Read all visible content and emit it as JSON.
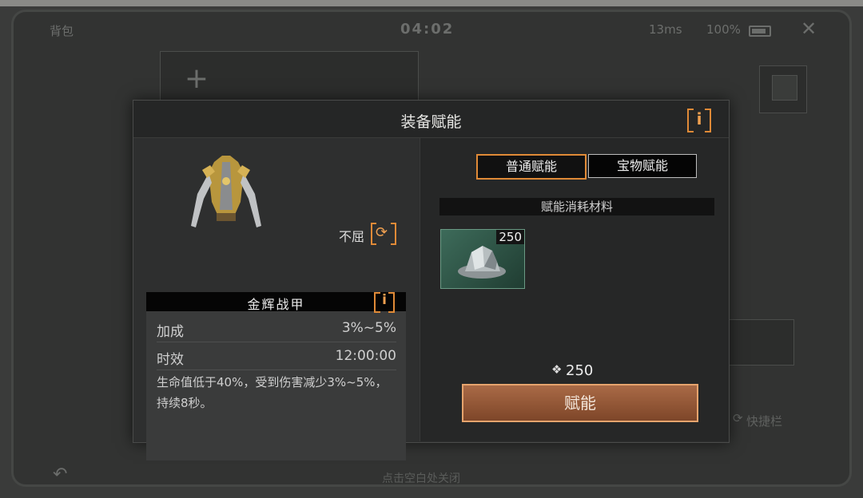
{
  "status": {
    "time": "04:02",
    "back_text": "背包",
    "ping": "13ms",
    "battery": "100%"
  },
  "background": {
    "hint": "点击空白处关闭",
    "quickbar": "快捷栏"
  },
  "modal": {
    "title": "装备赋能",
    "info_icon": "i",
    "item": {
      "attribute": "不屈",
      "refresh_icon": "refresh-icon",
      "name": "金辉战甲",
      "stats": [
        {
          "label": "加成",
          "value": "3%~5%"
        },
        {
          "label": "时效",
          "value": "12:00:00"
        }
      ],
      "description": "生命值低于40%，受到伤害减少3%~5%，持续8秒。"
    },
    "tabs": [
      {
        "label": "普通赋能",
        "active": true
      },
      {
        "label": "宝物赋能",
        "active": false
      }
    ],
    "materials_header": "赋能消耗材料",
    "material": {
      "qty": "250",
      "icon": "ore-icon"
    },
    "cost": "250",
    "action_label": "赋能"
  },
  "colors": {
    "accent": "#e08a37",
    "button": "#8f5535",
    "material_bg": "#2f5a4a"
  }
}
